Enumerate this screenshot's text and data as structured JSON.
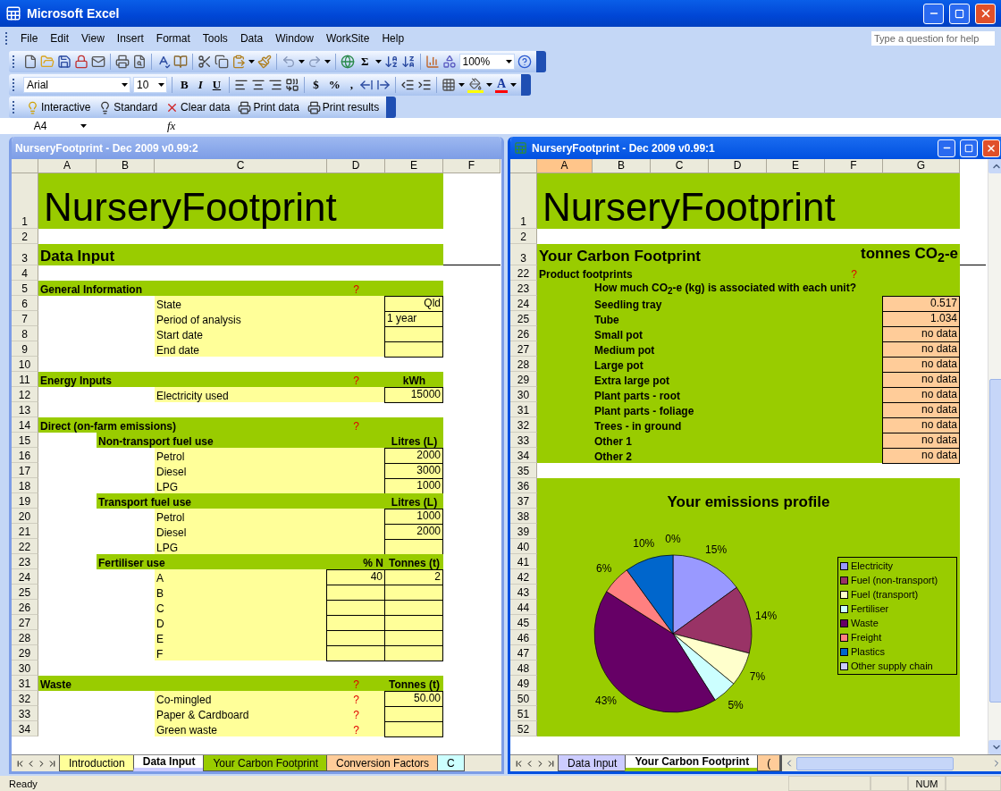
{
  "app": {
    "title": "Microsoft Excel"
  },
  "menu": [
    "File",
    "Edit",
    "View",
    "Insert",
    "Format",
    "Tools",
    "Data",
    "Window",
    "WorkSite",
    "Help"
  ],
  "help_box": {
    "placeholder": "Type a question for help"
  },
  "standard_toolbar": {
    "sum": "Σ",
    "zoom": "100%"
  },
  "formatting_toolbar": {
    "font": "Arial",
    "size": "10",
    "bold": "B",
    "italic": "I",
    "underline": "U",
    "currency": "$",
    "percent": "%",
    "comma": ",",
    "font_color": "A"
  },
  "custom_toolbar": [
    {
      "label": "Interactive"
    },
    {
      "label": "Standard"
    },
    {
      "label": "Clear data"
    },
    {
      "label": "Print data"
    },
    {
      "label": "Print results"
    }
  ],
  "formula_bar": {
    "name_box": "A4",
    "fx": "fx"
  },
  "windows": [
    {
      "kind": "input",
      "title": "NurseryFootprint - Dec 2009 v0.99:2",
      "active": false,
      "columns": [
        {
          "label": "A",
          "selected": false
        },
        {
          "label": "B",
          "selected": false
        },
        {
          "label": "C",
          "selected": false
        },
        {
          "label": "D",
          "selected": false
        },
        {
          "label": "E",
          "selected": false
        },
        {
          "label": "F",
          "selected": false
        }
      ],
      "rows": [
        {
          "num": "1",
          "kind": "title",
          "label": "NurseryFootprint"
        },
        {
          "num": "2",
          "kind": "blank"
        },
        {
          "num": "3",
          "kind": "heading",
          "label": "Data Input"
        },
        {
          "num": "4",
          "kind": "blank"
        },
        {
          "num": "5",
          "kind": "section",
          "label": "General Information",
          "help": "?"
        },
        {
          "num": "6",
          "kind": "item",
          "label": "State",
          "box_e": true,
          "e": "Qld"
        },
        {
          "num": "7",
          "kind": "item",
          "label": "Period of analysis",
          "box_e": true,
          "e": "1 year",
          "left_aligned": true
        },
        {
          "num": "8",
          "kind": "item",
          "label": "Start date",
          "box_e": true
        },
        {
          "num": "9",
          "kind": "item",
          "label": "End date",
          "box_e": true
        },
        {
          "num": "10",
          "kind": "blank"
        },
        {
          "num": "11",
          "kind": "section",
          "label": "Energy Inputs",
          "help": "?",
          "unit": "kWh"
        },
        {
          "num": "12",
          "kind": "item",
          "label": "Electricity used",
          "box_e": true,
          "e": "15000"
        },
        {
          "num": "13",
          "kind": "blank"
        },
        {
          "num": "14",
          "kind": "section",
          "label": "Direct (on-farm emissions)",
          "help": "?"
        },
        {
          "num": "15",
          "kind": "subsection",
          "label": "Non-transport fuel use",
          "unit": "Litres (L)"
        },
        {
          "num": "16",
          "kind": "item",
          "label": "Petrol",
          "box_e": true,
          "e": "2000"
        },
        {
          "num": "17",
          "kind": "item",
          "label": "Diesel",
          "box_e": true,
          "e": "3000"
        },
        {
          "num": "18",
          "kind": "item",
          "label": "LPG",
          "box_e": true,
          "e": "1000"
        },
        {
          "num": "19",
          "kind": "subsection",
          "label": "Transport fuel use",
          "unit": "Litres (L)"
        },
        {
          "num": "20",
          "kind": "item",
          "label": "Petrol",
          "box_e": true,
          "e": "1000"
        },
        {
          "num": "21",
          "kind": "item",
          "label": "Diesel",
          "box_e": true,
          "e": "2000"
        },
        {
          "num": "22",
          "kind": "item",
          "label": "LPG",
          "box_e": true
        },
        {
          "num": "23",
          "kind": "subsection",
          "label": "Fertiliser use",
          "unit_d": "% N",
          "unit": "Tonnes (t)"
        },
        {
          "num": "24",
          "kind": "item",
          "label": "A",
          "box_d": true,
          "d": "40",
          "box_e": true,
          "e": "2"
        },
        {
          "num": "25",
          "kind": "item",
          "label": "B",
          "box_d": true,
          "box_e": true
        },
        {
          "num": "26",
          "kind": "item",
          "label": "C",
          "box_d": true,
          "box_e": true
        },
        {
          "num": "27",
          "kind": "item",
          "label": "D",
          "box_d": true,
          "box_e": true
        },
        {
          "num": "28",
          "kind": "item",
          "label": "E",
          "box_d": true,
          "box_e": true
        },
        {
          "num": "29",
          "kind": "item",
          "label": "F",
          "box_d": true,
          "box_e": true
        },
        {
          "num": "30",
          "kind": "blank"
        },
        {
          "num": "31",
          "kind": "section",
          "label": "Waste",
          "help": "?",
          "unit": "Tonnes (t)"
        },
        {
          "num": "32",
          "kind": "item",
          "label": "Co-mingled",
          "help": "?",
          "box_e": true,
          "e": "50.00"
        },
        {
          "num": "33",
          "kind": "item",
          "label": "Paper & Cardboard",
          "help": "?",
          "box_e": true
        },
        {
          "num": "34",
          "kind": "item",
          "label": "Green waste",
          "help": "?",
          "box_e": true
        }
      ],
      "tabs": [
        {
          "label": "Introduction",
          "color": "#ffff99",
          "selected": false
        },
        {
          "label": "Data Input",
          "color": "#ccccff",
          "selected": true
        },
        {
          "label": "Your Carbon Footprint",
          "color": "#99cc00",
          "selected": false
        },
        {
          "label": "Conversion Factors",
          "color": "#ffcc99",
          "selected": false
        },
        {
          "label": "C",
          "color": "#ccffff",
          "selected": false
        }
      ]
    },
    {
      "kind": "report",
      "title": "NurseryFootprint - Dec 2009 v0.99:1",
      "active": true,
      "columns": [
        {
          "label": "A",
          "selected": true
        },
        {
          "label": "B",
          "selected": false
        },
        {
          "label": "C",
          "selected": false
        },
        {
          "label": "D",
          "selected": false
        },
        {
          "label": "E",
          "selected": false
        },
        {
          "label": "F",
          "selected": false
        },
        {
          "label": "G",
          "selected": false
        }
      ],
      "rows": [
        {
          "num": "1",
          "kind": "title",
          "label": "NurseryFootprint"
        },
        {
          "num": "2",
          "kind": "blank"
        },
        {
          "num": "3",
          "kind": "heading",
          "label": "Your Carbon Footprint",
          "unit": "tonnes CO$_{2}$-e"
        },
        {
          "num": "22",
          "kind": "section",
          "label": "Product footprints",
          "help": "?"
        },
        {
          "num": "23",
          "kind": "note",
          "label": "How much CO$_{2}$-e (kg) is associated with each unit?"
        },
        {
          "num": "24",
          "kind": "item",
          "label": "Seedling tray",
          "box_e": true,
          "e": "0.517"
        },
        {
          "num": "25",
          "kind": "item",
          "label": "Tube",
          "box_e": true,
          "e": "1.034"
        },
        {
          "num": "26",
          "kind": "item",
          "label": "Small pot",
          "box_e": true,
          "e": "no data"
        },
        {
          "num": "27",
          "kind": "item",
          "label": "Medium pot",
          "box_e": true,
          "e": "no data"
        },
        {
          "num": "28",
          "kind": "item",
          "label": "Large pot",
          "box_e": true,
          "e": "no data"
        },
        {
          "num": "29",
          "kind": "item",
          "label": "Extra large pot",
          "box_e": true,
          "e": "no data"
        },
        {
          "num": "30",
          "kind": "item",
          "label": "Plant parts - root",
          "box_e": true,
          "e": "no data"
        },
        {
          "num": "31",
          "kind": "item",
          "label": "Plant parts - foliage",
          "box_e": true,
          "e": "no data"
        },
        {
          "num": "32",
          "kind": "item",
          "label": "Trees - in ground",
          "box_e": true,
          "e": "no data"
        },
        {
          "num": "33",
          "kind": "item",
          "label": "Other 1",
          "box_e": true,
          "e": "no data"
        },
        {
          "num": "34",
          "kind": "item",
          "label": "Other 2",
          "box_e": true,
          "e": "no data"
        },
        {
          "num": "35",
          "kind": "blank"
        }
      ],
      "chart_rows": [
        "36",
        "37",
        "38",
        "39",
        "40",
        "41",
        "42",
        "43",
        "44",
        "45",
        "46",
        "47",
        "48",
        "49",
        "50",
        "51",
        "52"
      ],
      "chart": {
        "chart_data": {
          "type": "pie",
          "title": "Your emissions profile",
          "categories": [
            "Electricity",
            "Fuel (non-transport)",
            "Fuel (transport)",
            "Fertiliser",
            "Waste",
            "Freight",
            "Plastics",
            "Other supply chain"
          ],
          "values": [
            15,
            14,
            7,
            5,
            43,
            6,
            10,
            0
          ],
          "value_labels": [
            "15%",
            "14%",
            "7%",
            "5%",
            "43%",
            "6%",
            "10%",
            "0%"
          ],
          "colors": [
            "#9999ff",
            "#993366",
            "#ffffcc",
            "#ccffff",
            "#660066",
            "#ff8080",
            "#0066cc",
            "#ccccff"
          ]
        }
      },
      "tabs": [
        {
          "label": "Data Input",
          "color": "#ccccff",
          "selected": false
        },
        {
          "label": "Your Carbon Footprint",
          "color": "#99cc00",
          "selected": true
        },
        {
          "label": "(",
          "color": "#ffcc99",
          "selected": false
        }
      ]
    }
  ],
  "status_bar": {
    "text": "Ready",
    "indicators": [
      "NUM"
    ]
  }
}
